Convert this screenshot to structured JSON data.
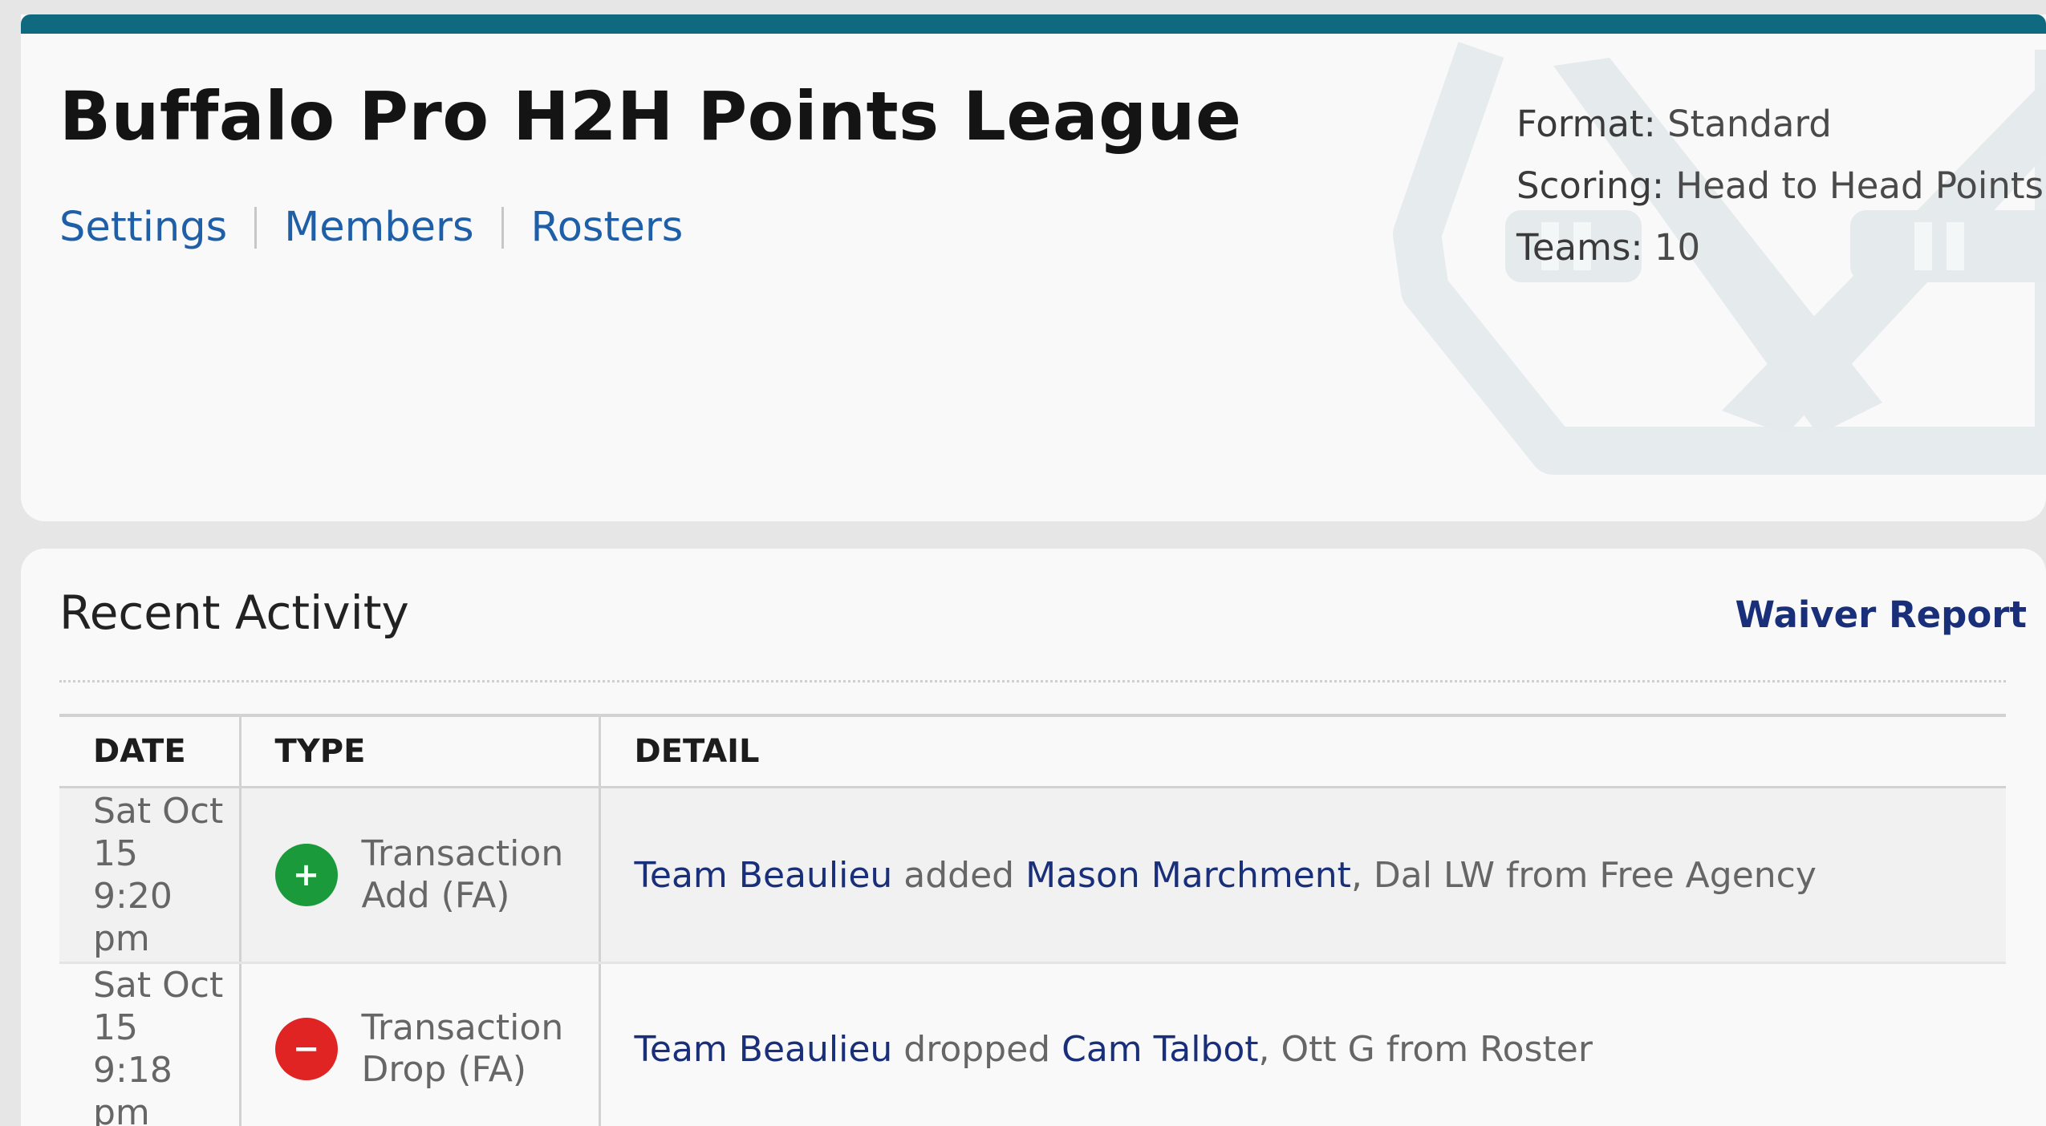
{
  "league": {
    "title": "Buffalo Pro H2H Points League",
    "nav": [
      "Settings",
      "Members",
      "Rosters"
    ],
    "meta": [
      {
        "label": "Format:",
        "value": "Standard"
      },
      {
        "label": "Scoring:",
        "value": "Head to Head Points"
      },
      {
        "label": "Teams:",
        "value": "10"
      }
    ],
    "accent_color": "#0f6a7f",
    "watermark_icon": "crossed-hockey-sticks-icon"
  },
  "activity": {
    "title": "Recent Activity",
    "waiver_link": "Waiver Report",
    "columns": [
      "DATE",
      "TYPE",
      "DETAIL"
    ],
    "rows": [
      {
        "date_day": "Sat Oct 15",
        "date_time": "9:20 pm",
        "icon": "add-plus-icon",
        "icon_glyph": "+",
        "icon_color": "#1b9a3c",
        "type_main": "Transaction",
        "type_sub": "Add (FA)",
        "team": "Team Beaulieu",
        "action": " added ",
        "player": "Mason Marchment",
        "rest": ", Dal LW from Free Agency"
      },
      {
        "date_day": "Sat Oct 15",
        "date_time": "9:18 pm",
        "icon": "drop-minus-icon",
        "icon_glyph": "−",
        "icon_color": "#e02424",
        "type_main": "Transaction",
        "type_sub": "Drop (FA)",
        "team": "Team Beaulieu",
        "action": " dropped ",
        "player": "Cam Talbot",
        "rest": ", Ott G from Roster"
      }
    ]
  }
}
